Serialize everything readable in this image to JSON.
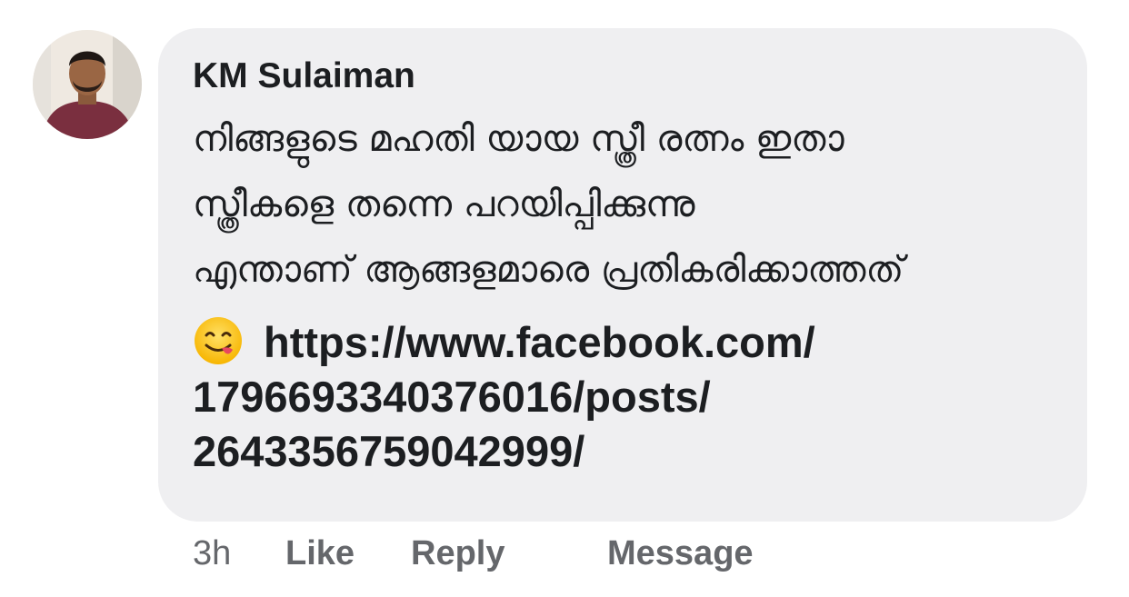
{
  "comment": {
    "author": "KM Sulaiman",
    "lines": [
      "നിങ്ങളുടെ മഹതി യായ സ്ത്രീ രത്നം ഇതാ",
      "സ്ത്രീകളെ തന്നെ പറയിപ്പിക്കുന്നു",
      "എന്താണ് ആങ്ങളമാരെ പ്രതികരിക്കാത്തത്"
    ],
    "emoji": "face-savoring-food-emoji",
    "link_lines": [
      "https://www.facebook.com/",
      "1796693340376016/posts/",
      "2643356759042999/"
    ]
  },
  "actions": {
    "time": "3h",
    "like": "Like",
    "reply": "Reply",
    "message": "Message"
  },
  "colors": {
    "bubble": "#efeff1",
    "text": "#1c1e21",
    "meta": "#65676b"
  }
}
